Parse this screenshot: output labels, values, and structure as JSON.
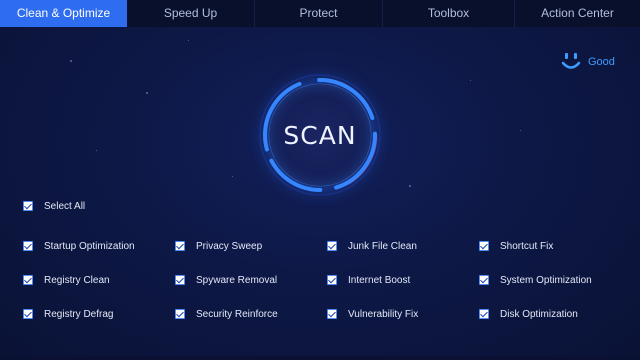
{
  "tabs": [
    {
      "label": "Clean & Optimize",
      "active": true
    },
    {
      "label": "Speed Up",
      "active": false
    },
    {
      "label": "Protect",
      "active": false
    },
    {
      "label": "Toolbox",
      "active": false
    },
    {
      "label": "Action Center",
      "active": false
    }
  ],
  "status": {
    "icon": "smiley-icon",
    "text": "Good"
  },
  "scan": {
    "label": "SCAN"
  },
  "select_all": {
    "label": "Select All",
    "checked": true
  },
  "options": [
    {
      "label": "Startup Optimization",
      "checked": true
    },
    {
      "label": "Privacy Sweep",
      "checked": true
    },
    {
      "label": "Junk File Clean",
      "checked": true
    },
    {
      "label": "Shortcut Fix",
      "checked": true
    },
    {
      "label": "Registry Clean",
      "checked": true
    },
    {
      "label": "Spyware Removal",
      "checked": true
    },
    {
      "label": "Internet Boost",
      "checked": true
    },
    {
      "label": "System Optimization",
      "checked": true
    },
    {
      "label": "Registry Defrag",
      "checked": true
    },
    {
      "label": "Security Reinforce",
      "checked": true
    },
    {
      "label": "Vulnerability Fix",
      "checked": true
    },
    {
      "label": "Disk Optimization",
      "checked": true
    }
  ],
  "colors": {
    "accent": "#2f6df0",
    "status": "#3f9cff",
    "ring": "#3a8dff",
    "background": "#0d1846"
  }
}
